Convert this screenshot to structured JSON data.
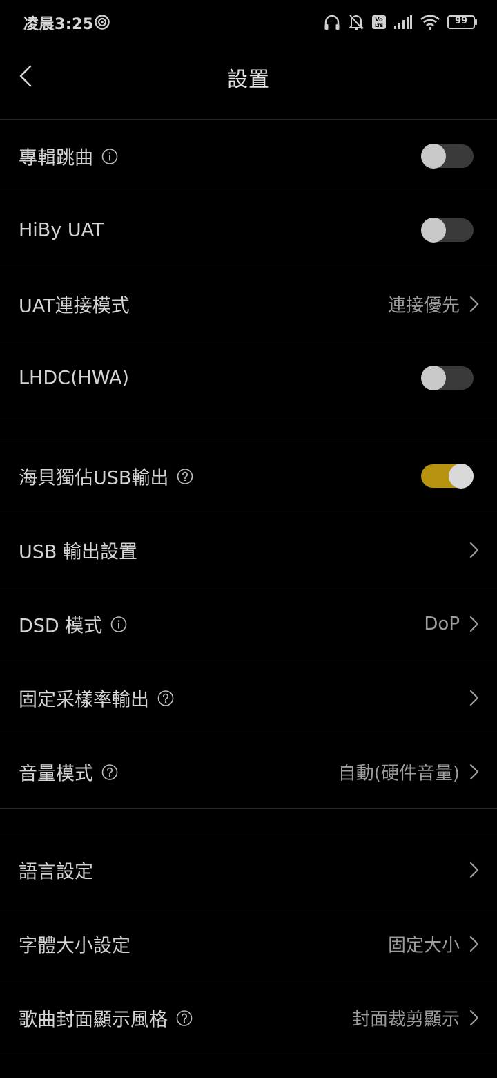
{
  "status_bar": {
    "time": "凌晨3:25",
    "battery": "99",
    "icons": [
      "headphones-icon",
      "bell-muted-icon",
      "volte-icon",
      "signal-icon",
      "wifi-icon",
      "battery-icon"
    ]
  },
  "header": {
    "title": "設置",
    "back_icon": "chevron-left-icon"
  },
  "settings": {
    "album_skip": {
      "label": "專輯跳曲",
      "enabled": false
    },
    "hiby_uat": {
      "label": "HiBy UAT",
      "enabled": false
    },
    "uat_mode": {
      "label": "UAT連接模式",
      "value": "連接優先"
    },
    "lhdc": {
      "label": "LHDC(HWA)",
      "enabled": false
    },
    "usb_exclusive": {
      "label": "海貝獨佔USB輸出",
      "enabled": true
    },
    "usb_output": {
      "label": "USB 輸出設置"
    },
    "dsd_mode": {
      "label": "DSD 模式",
      "value": "DoP"
    },
    "fixed_rate": {
      "label": "固定采樣率輸出"
    },
    "volume_mode": {
      "label": "音量模式",
      "value": "自動(硬件音量)"
    },
    "language": {
      "label": "語言設定"
    },
    "font_size": {
      "label": "字體大小設定",
      "value": "固定大小"
    },
    "cover_style": {
      "label": "歌曲封面顯示風格",
      "value": "封面裁剪顯示"
    }
  },
  "colors": {
    "background": "#000000",
    "accent": "#b8930f",
    "divider": "#262626"
  }
}
